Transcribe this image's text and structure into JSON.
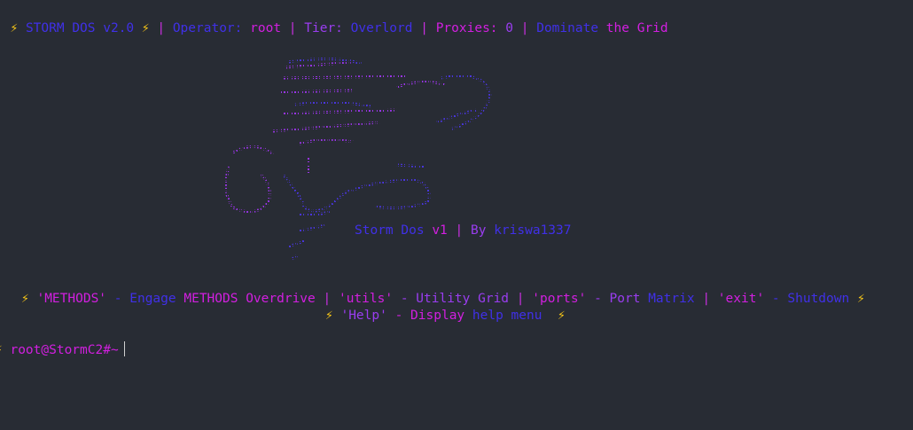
{
  "header": {
    "bolt_left": "⚡",
    "brand": "STORM DOS v2.0",
    "bolt_mid": "⚡",
    "sep1": "|",
    "operator_label": "Operator:",
    "operator_value": "root",
    "sep2": "|",
    "tier_label": "Tier:",
    "tier_value": "Overlord",
    "sep3": "|",
    "proxies_label": "Proxies:",
    "proxies_value": "0",
    "sep4": "|",
    "tagline_a": "Dominate",
    "tagline_b": "the Grid"
  },
  "banner": {
    "title_a": "Storm Dos",
    "title_b": "v1",
    "sep": "|",
    "by_a": "By",
    "by_b": "kriswa1337"
  },
  "menu": {
    "bolt": "⚡",
    "methods_cmd": "'METHODS'",
    "methods_desc_a": "- Engage",
    "methods_desc_b": "METHODS Overdrive",
    "sep": "|",
    "utils_cmd": "'utils'",
    "utils_desc": "- Utility Grid",
    "ports_cmd": "'ports'",
    "ports_desc_a": "- Port",
    "ports_desc_b": "Matrix",
    "exit_cmd": "'exit'",
    "exit_desc": "- Shutdown",
    "help_cmd": "'Help'",
    "help_desc_a": "- Display",
    "help_desc_b": "help menu"
  },
  "prompt": {
    "bolt": "⚡",
    "text": "root@StormC2#~"
  }
}
